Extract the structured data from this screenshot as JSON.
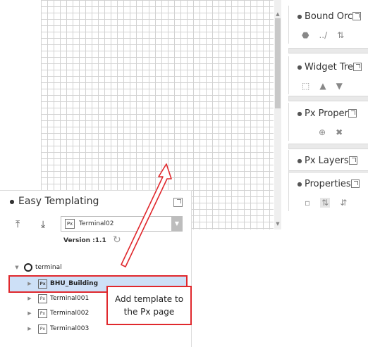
{
  "right_panels": [
    {
      "title": "Bound Orc",
      "tools": [
        "tag-icon",
        "slash-icon",
        "sort-az-icon"
      ],
      "tool_glyphs": [
        "⬣",
        "..∕",
        "⇅"
      ]
    },
    {
      "title": "Widget Tre",
      "tools": [
        "select-icon",
        "up-icon",
        "down-icon"
      ],
      "tool_glyphs": [
        "⬚",
        "▲",
        "▼"
      ]
    },
    {
      "title": "Px Proper",
      "tools": [
        "add-icon",
        "remove-icon"
      ],
      "tool_glyphs": [
        "⊕",
        "✖"
      ]
    },
    {
      "title": "Px Layers",
      "tools": [],
      "tool_glyphs": []
    },
    {
      "title": "Properties",
      "tools": [
        "category-icon",
        "sort-alpha-icon",
        "sort-icon"
      ],
      "tool_glyphs": [
        "▫",
        "⇅",
        "⇵"
      ]
    }
  ],
  "easy_templating": {
    "title": "Easy Templating",
    "selected_template": "Terminal02",
    "version": "Version :1.1",
    "upload_glyph": "⤒",
    "download_glyph": "⤓",
    "dropdown_glyph": "▼",
    "refresh_glyph": "↻",
    "tree": {
      "root": "terminal",
      "items": [
        "BHU_Building",
        "Terminal001",
        "Terminal002",
        "Terminal003"
      ],
      "px_icon_text": "Px"
    }
  },
  "callout": {
    "line1": "Add template to",
    "line2": "the Px page"
  },
  "colors": {
    "highlight": "#cde0f7",
    "annotation_red": "#e0282d"
  }
}
